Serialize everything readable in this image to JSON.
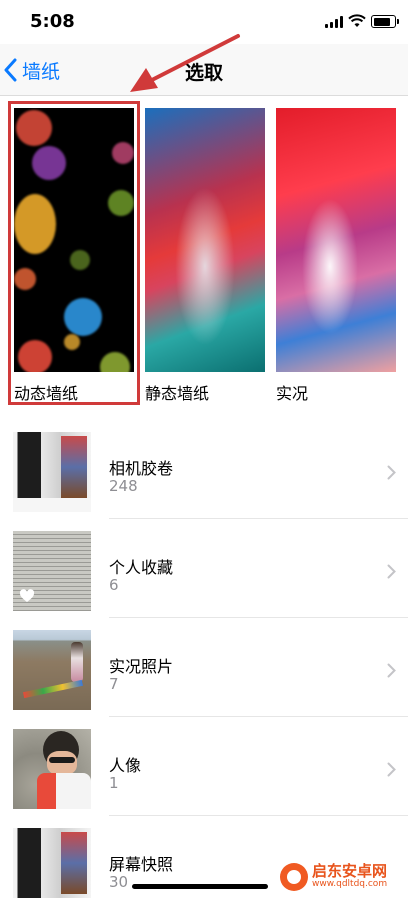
{
  "status_bar": {
    "time": "5:08",
    "battery_level": 0.85
  },
  "nav": {
    "back_label": "墙纸",
    "title": "选取"
  },
  "wallpaper_categories": [
    {
      "label": "动态墙纸",
      "highlighted": true
    },
    {
      "label": "静态墙纸",
      "highlighted": false
    },
    {
      "label": "实况",
      "highlighted": false
    }
  ],
  "albums": [
    {
      "name": "相机胶卷",
      "count": "248",
      "thumb": "screenshot"
    },
    {
      "name": "个人收藏",
      "count": "6",
      "thumb": "document-heart"
    },
    {
      "name": "实况照片",
      "count": "7",
      "thumb": "beach"
    },
    {
      "name": "人像",
      "count": "1",
      "thumb": "child"
    },
    {
      "name": "屏幕快照",
      "count": "30",
      "thumb": "screenshot"
    }
  ],
  "watermark": {
    "text": "启东安卓网",
    "url": "www.qdltdq.com"
  },
  "colors": {
    "accent": "#0a7aff",
    "annotation": "#d03a3a"
  }
}
